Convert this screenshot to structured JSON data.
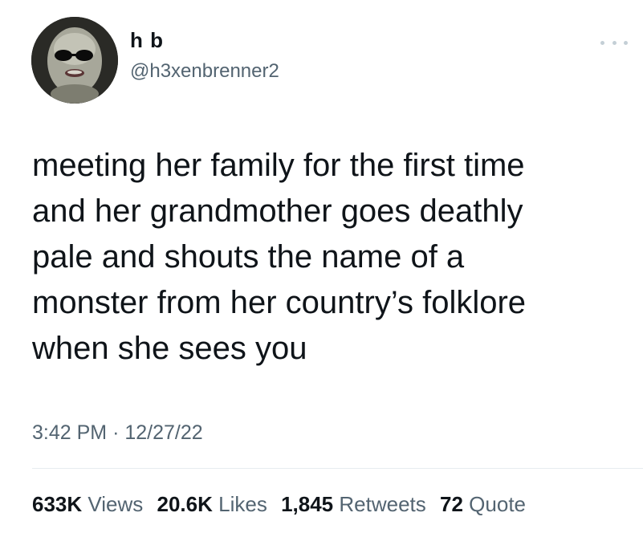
{
  "author": {
    "display_name": "h b",
    "handle": "@h3xenbrenner2",
    "avatar_icon": "profile-avatar"
  },
  "tweet": {
    "text": "meeting her family for the first time\nand her grandmother goes deathly\npale and shouts the name of a\nmonster from her country’s folklore\nwhen she sees you",
    "time": "3:42 PM",
    "separator": "·",
    "date": "12/27/22"
  },
  "stats": {
    "views_count": "633K",
    "views_label": "Views",
    "likes_count": "20.6K",
    "likes_label": "Likes",
    "retweets_count": "1,845",
    "retweets_label": "Retweets",
    "quotes_count": "72",
    "quotes_label": "Quote"
  },
  "icons": {
    "more": "more-dots-icon"
  },
  "colors": {
    "text": "#0f1419",
    "secondary": "#536471",
    "divider": "#e6ecf0"
  }
}
